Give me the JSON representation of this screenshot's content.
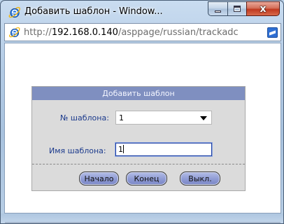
{
  "window": {
    "title": "Добавить шаблон - Window...",
    "controls": {
      "minimize": "minimize",
      "maximize": "maximize",
      "close": "x"
    }
  },
  "address_bar": {
    "url_prefix": "http://",
    "url_host": "192.168.0.140",
    "url_path": "/asppage/russian/trackadc",
    "icon": "ie-icon"
  },
  "form": {
    "header": "Добавить шаблон",
    "template_number": {
      "label": "№ шаблона:",
      "value": "1"
    },
    "template_name": {
      "label": "Имя шаблона:",
      "value": "1"
    },
    "buttons": {
      "start": "Начало",
      "end": "Конец",
      "off": "Выкл."
    }
  },
  "colors": {
    "panel_header": "#7f8fc0",
    "panel_bg": "#dbdbdb",
    "label_text": "#1b3a8c",
    "button": "#8f9bd4"
  }
}
